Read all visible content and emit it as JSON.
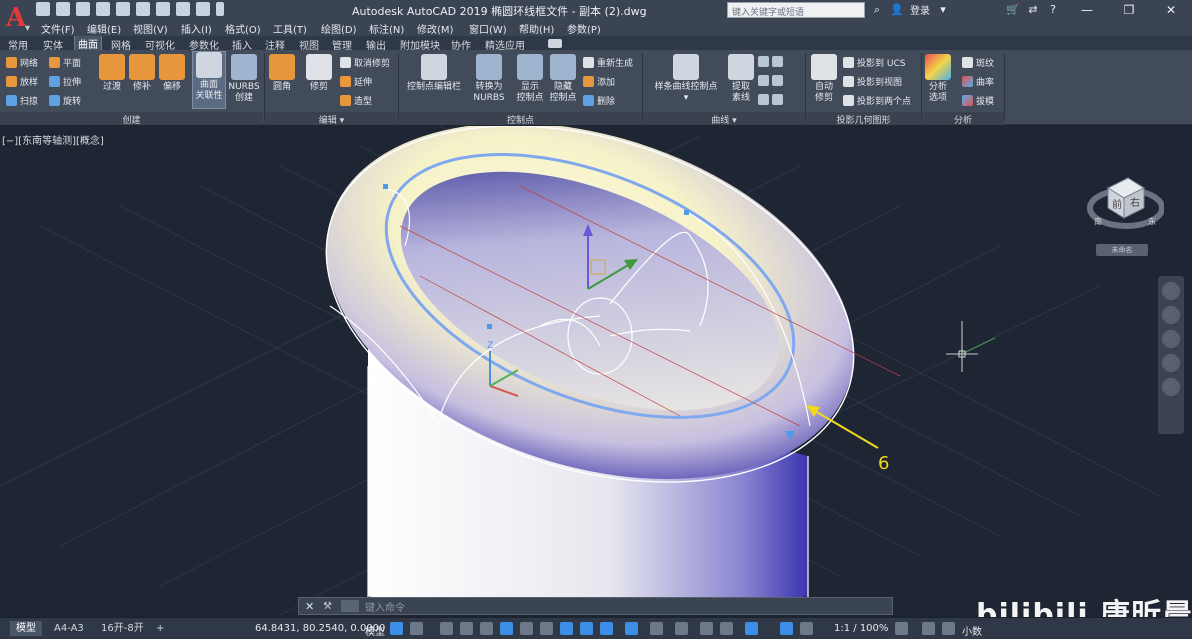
{
  "app": {
    "logo": "A",
    "title": "Autodesk AutoCAD 2019    椭圆环线框文件 - 副本 (2).dwg",
    "search_placeholder": "键入关键字或短语",
    "login": "登录"
  },
  "menu": [
    "文件(F)",
    "编辑(E)",
    "视图(V)",
    "插入(I)",
    "格式(O)",
    "工具(T)",
    "绘图(D)",
    "标注(N)",
    "修改(M)",
    "窗口(W)",
    "帮助(H)",
    "参数(P)"
  ],
  "ribbon_tabs": [
    "常用",
    "实体",
    "曲面",
    "网格",
    "可视化",
    "参数化",
    "插入",
    "注释",
    "视图",
    "管理",
    "输出",
    "附加模块",
    "协作",
    "精选应用"
  ],
  "ribbon_active_tab": "曲面",
  "ribbon": {
    "create": {
      "label": "创建",
      "small": [
        "网络",
        "放样",
        "扫掠",
        "平面",
        "拉伸",
        "旋转"
      ],
      "big": [
        "过渡",
        "修补",
        "偏移",
        "曲面\n关联性",
        "NURBS\n创建"
      ]
    },
    "edit": {
      "label": "编辑",
      "big": [
        "圆角",
        "修剪"
      ],
      "small": [
        "取消修剪",
        "延伸",
        "造型"
      ]
    },
    "control_points": {
      "label": "控制点",
      "big": [
        "控制点编辑栏",
        "转换为\nNURBS",
        "显示\n控制点",
        "隐藏\n控制点"
      ],
      "small": [
        "重新生成",
        "添加",
        "删除"
      ]
    },
    "curves": {
      "label": "曲线",
      "big": [
        "样条曲线控制点",
        "提取\n素线"
      ]
    },
    "projection": {
      "label": "投影几何图形",
      "big": [
        "自动\n修剪"
      ],
      "small": [
        "投影到 UCS",
        "投影到视图",
        "投影到两个点"
      ]
    },
    "analysis": {
      "label": "分析",
      "big": [
        "分析\n选项"
      ],
      "small": [
        "斑纹",
        "曲率",
        "拔模"
      ]
    }
  },
  "viewport": {
    "label": "[−][东南等轴测][概念]",
    "annotation": "6",
    "nav_cube": {
      "front": "前",
      "right": "右",
      "south": "南",
      "east": "东",
      "unnamed": "未命名"
    }
  },
  "command_line": {
    "placeholder": "键入命令"
  },
  "status": {
    "layout_tabs": [
      "模型",
      "A4-A3",
      "16开-8开"
    ],
    "active_layout": "模型",
    "add_tab": "+",
    "coords": "64.8431, 80.2540, 0.0000",
    "model_label": "模型",
    "scale": "1:1 / 100%",
    "units": "小数"
  },
  "watermark": "bilibili 唐昕晨",
  "colors": {
    "accent": "#3d8ee6",
    "annotation": "#f2d81d",
    "torus_light": "#fbf8d6",
    "torus_dark": "#3b34a8"
  }
}
